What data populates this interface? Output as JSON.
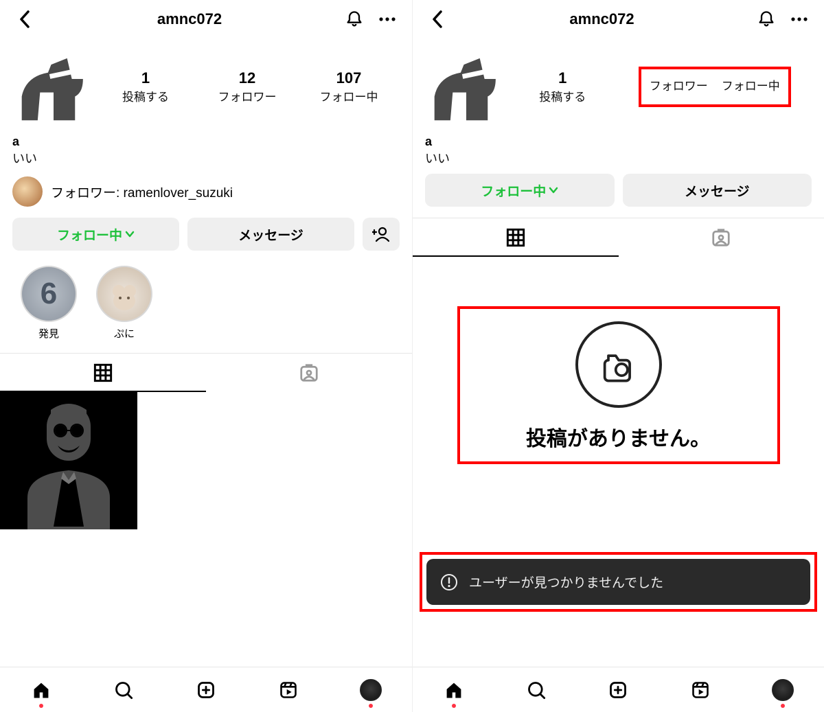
{
  "left": {
    "header": {
      "username": "amnc072"
    },
    "stats": {
      "posts_num": "1",
      "posts_label": "投稿する",
      "followers_num": "12",
      "followers_label": "フォロワー",
      "following_num": "107",
      "following_label": "フォロー中"
    },
    "name": "a",
    "bio": "いい",
    "follower_of": "フォロワー: ramenlover_suzuki",
    "actions": {
      "following": "フォロー中",
      "message": "メッセージ"
    },
    "highlights": [
      {
        "label": "発見",
        "display": "6"
      },
      {
        "label": "ぷに",
        "display": ""
      }
    ]
  },
  "right": {
    "header": {
      "username": "amnc072"
    },
    "stats": {
      "posts_num": "1",
      "posts_label": "投稿する",
      "followers_label": "フォロワー",
      "following_label": "フォロー中"
    },
    "name": "a",
    "bio": "いい",
    "actions": {
      "following": "フォロー中",
      "message": "メッセージ"
    },
    "empty_state": "投稿がありません。",
    "toast": "ユーザーが見つかりませんでした"
  },
  "icons": {
    "back": "back-icon",
    "bell": "bell-icon",
    "more": "more-icon",
    "chevron": "chevron-down-icon",
    "add_user": "add-user-icon",
    "grid": "grid-icon",
    "tagged": "tagged-icon",
    "camera": "camera-icon",
    "alert": "alert-icon",
    "home": "home-icon",
    "search": "search-icon",
    "create": "create-icon",
    "reels": "reels-icon"
  }
}
